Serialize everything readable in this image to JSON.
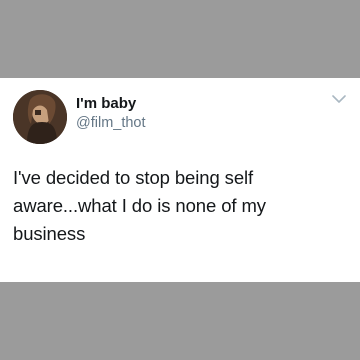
{
  "tweet": {
    "display_name": "I'm baby",
    "handle": "@film_thot",
    "text": "I've decided to stop being self aware...what I do is none of my business",
    "avatar_icon": "user-avatar",
    "menu_icon": "chevron-down-icon"
  },
  "colors": {
    "background": "#9b9b9b",
    "card": "#ffffff",
    "name": "#14171a",
    "handle": "#657786"
  }
}
